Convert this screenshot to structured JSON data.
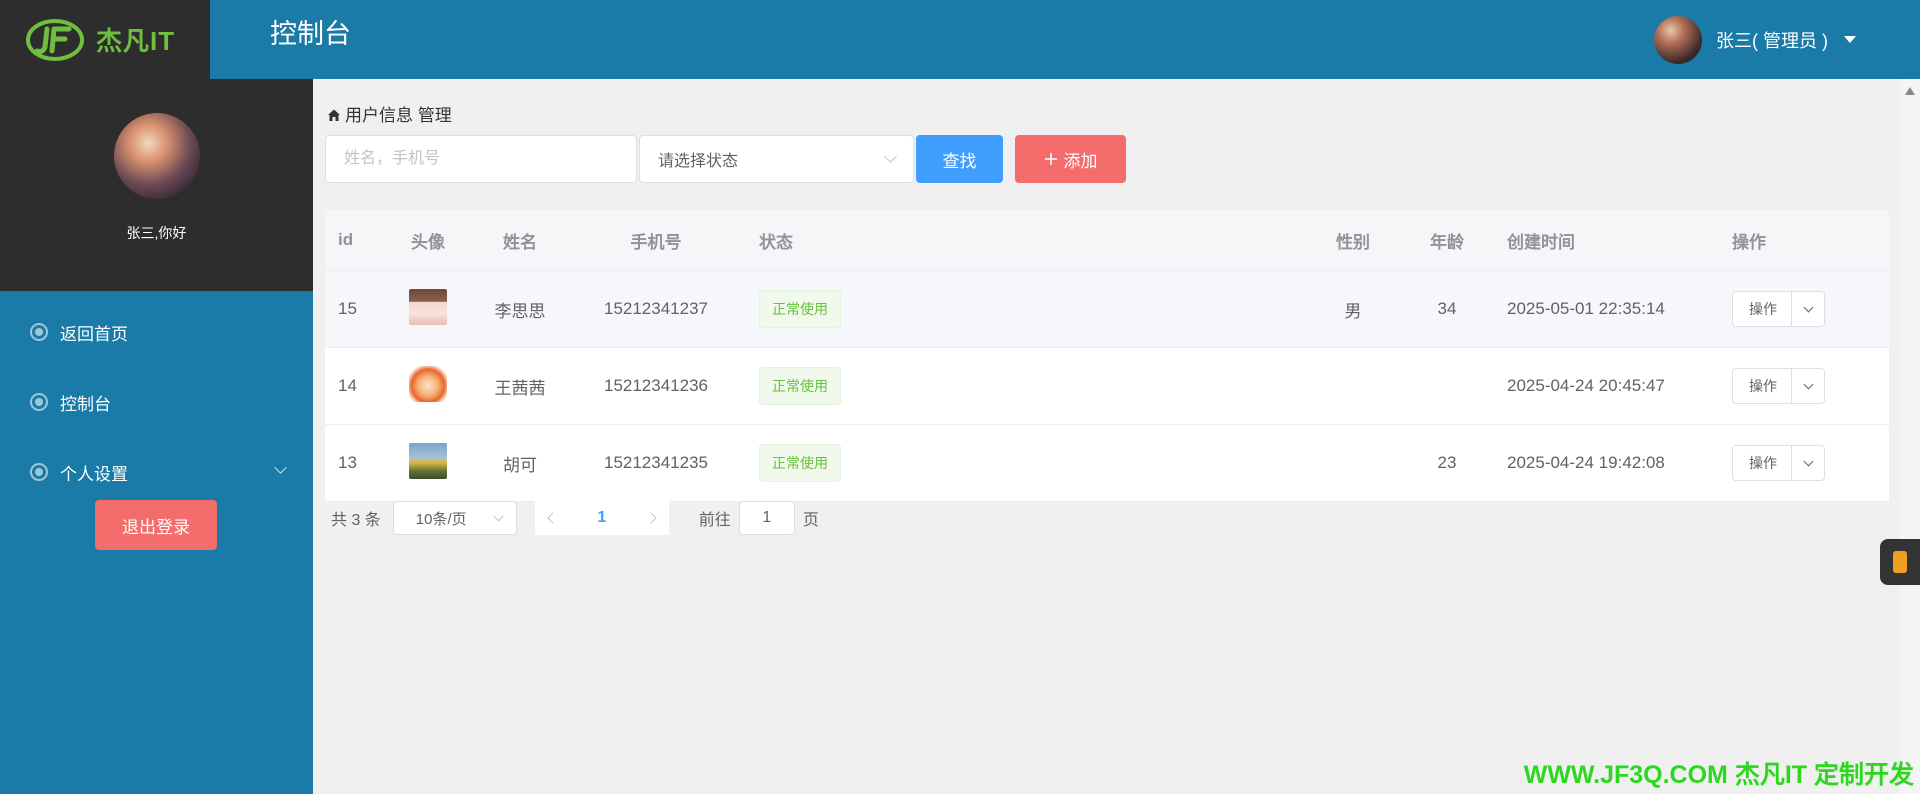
{
  "header": {
    "logo_text": "杰凡IT",
    "page_title": "控制台",
    "user_label": "张三( 管理员 )"
  },
  "sidebar": {
    "greeting": "张三,你好",
    "items": [
      {
        "label": "返回首页"
      },
      {
        "label": "控制台"
      },
      {
        "label": "个人设置"
      }
    ],
    "logout_label": "退出登录"
  },
  "main": {
    "breadcrumb": "用户信息 管理",
    "search": {
      "placeholder": "姓名，手机号"
    },
    "status_select": {
      "placeholder": "请选择状态"
    },
    "find_label": "查找",
    "add_label": "添加",
    "table": {
      "headers": {
        "id": "id",
        "avatar": "头像",
        "name": "姓名",
        "phone": "手机号",
        "status": "状态",
        "gender": "性别",
        "age": "年龄",
        "created": "创建时间",
        "ops": "操作"
      },
      "rows": [
        {
          "id": "15",
          "name": "李思思",
          "phone": "15212341237",
          "status": "正常使用",
          "gender": "男",
          "age": "34",
          "created": "2025-05-01 22:35:14",
          "op": "操作"
        },
        {
          "id": "14",
          "name": "王茜茜",
          "phone": "15212341236",
          "status": "正常使用",
          "gender": "",
          "age": "",
          "created": "2025-04-24 20:45:47",
          "op": "操作"
        },
        {
          "id": "13",
          "name": "胡可",
          "phone": "15212341235",
          "status": "正常使用",
          "gender": "",
          "age": "23",
          "created": "2025-04-24 19:42:08",
          "op": "操作"
        }
      ]
    },
    "pagination": {
      "total": "共 3 条",
      "page_size": "10条/页",
      "current_page": "1",
      "goto_label": "前往",
      "goto_value": "1",
      "goto_suffix": "页"
    }
  },
  "watermark": "WWW.JF3Q.COM 杰凡IT  定制开发",
  "colors": {
    "header_bg": "#1b7ba8",
    "sidebar_dark": "#2d2d2d",
    "primary": "#409eff",
    "danger": "#f56c6c",
    "success": "#67c23a",
    "watermark": "#2bd81e"
  }
}
